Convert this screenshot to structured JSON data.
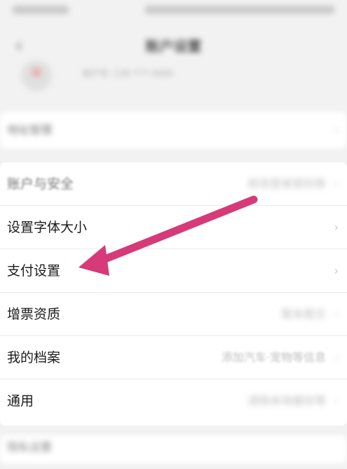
{
  "header": {
    "title": "账户设置"
  },
  "profile": {
    "phone": "账户号: 138 **** 0000"
  },
  "address": {
    "label": "地址管理"
  },
  "settings": {
    "items": [
      {
        "label": "账户与安全",
        "value": "修改登录密码等"
      },
      {
        "label": "设置字体大小",
        "value": ""
      },
      {
        "label": "支付设置",
        "value": ""
      },
      {
        "label": "增票资质",
        "value": "暂未提交"
      },
      {
        "label": "我的档案",
        "value": "添加汽车·宠物等信息"
      },
      {
        "label": "通用",
        "value": "清除本地缓存等"
      }
    ]
  },
  "bottom": {
    "label": "隐私设置"
  },
  "colors": {
    "arrow": "#d63a78",
    "background": "#f2f2f2"
  },
  "icons": {
    "back": "chevron-left-icon",
    "row_arrow": "chevron-right-icon",
    "annotation": "arrow-icon"
  }
}
